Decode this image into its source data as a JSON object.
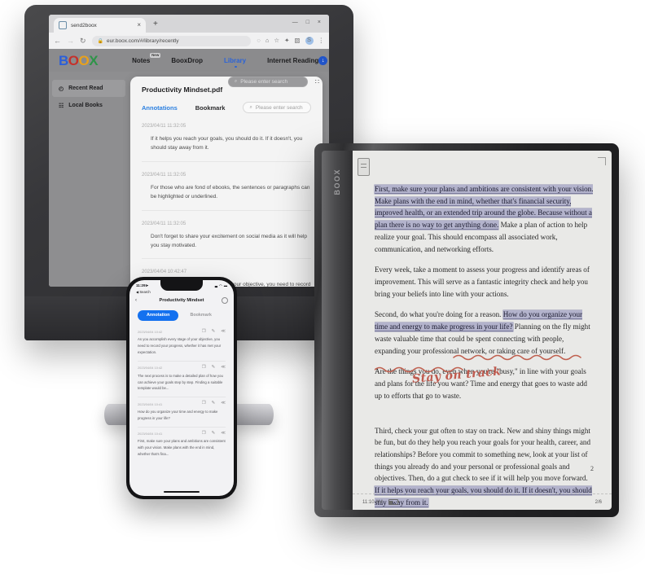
{
  "browser": {
    "tab_title": "send2boox",
    "tab_close": "×",
    "new_tab": "+",
    "window_controls": "— □ ×",
    "back_icon": "←",
    "forward_icon": "→",
    "reload_icon": "↻",
    "lock_icon": "🔒",
    "url": "eur.boox.com/#/library/recently",
    "extension_icons": [
      "◌",
      "⌂",
      "☆",
      "✦",
      "▧"
    ],
    "profile_initial": "S",
    "menu_icon": "⋮"
  },
  "site": {
    "logo": {
      "b": "B",
      "o1": "O",
      "o2": "O",
      "x": "X"
    },
    "nav": [
      {
        "label": "Notes",
        "badge": "New",
        "active": false
      },
      {
        "label": "BooxDrop",
        "badge": "",
        "active": false
      },
      {
        "label": "Library",
        "badge": "",
        "active": true
      },
      {
        "label": "Internet Reading",
        "badge": "",
        "active": false
      }
    ],
    "header_icons": [
      "download-icon",
      "storage-icon",
      "headset-icon",
      "account-icon"
    ],
    "download_glyph": "↓",
    "storage_glyph": "◎",
    "headset_glyph": "⌢",
    "account_glyph": "⚲",
    "dropdown_caret": "▾",
    "sidebar": [
      {
        "label": "Recent Read",
        "icon": "◴",
        "active": true
      },
      {
        "label": "Local Books",
        "icon": "☷",
        "active": false
      }
    ],
    "top_search": {
      "placeholder": "Please enter search",
      "icon": "⌕"
    },
    "grid_icon": "∷"
  },
  "card": {
    "title": "Productivity Mindset.pdf",
    "tabs": [
      {
        "label": "Annotations",
        "active": true
      },
      {
        "label": "Bookmark",
        "active": false
      }
    ],
    "search": {
      "placeholder": "Please enter search",
      "icon": "⌕"
    },
    "annotations": [
      {
        "date": "2023/04/11 11:32:05",
        "text": "If it helps you reach your goals, you should do it. If it doesn't, you should stay away from it."
      },
      {
        "date": "2023/04/11 11:32:05",
        "text": "For those who are fond of ebooks, the sentences or paragraphs can be highlighted or underlined."
      },
      {
        "date": "2023/04/11 11:32:05",
        "text": "Don't forget to share your excitement on social media as it will help you stay motivated."
      },
      {
        "date": "2023/04/04 10:42:47",
        "text": "As you accomplish every stage of your objective, you need to record your progress."
      }
    ]
  },
  "tablet": {
    "brand": "BOOX",
    "page_number": "2",
    "status": {
      "time": "11:10 AM",
      "battery_icon": "battery-icon",
      "progress": "2/6"
    },
    "handwritten_note": "Stay on track",
    "paragraphs": [
      {
        "runs": [
          {
            "t": "First, make sure your plans and ambitions are consistent with your vision. Make plans with the end in mind, whether that's financial security, improved health, or an extended trip around the globe. Because without a plan there is no way to get anything done.",
            "highlight": true
          },
          {
            "t": " Make a plan of action to help realize your goal. This should encompass all associated work, communication, and networking efforts.",
            "highlight": false
          }
        ]
      },
      {
        "runs": [
          {
            "t": "Every week, take a moment to assess your progress and identify areas of improvement. This will serve as a fantastic integrity check and help you bring your beliefs into line with your actions.",
            "highlight": false
          }
        ]
      },
      {
        "runs": [
          {
            "t": "Second, do what you're doing for a reason. ",
            "highlight": false
          },
          {
            "t": "How do you organize your time and energy to make progress in your life?",
            "highlight": true
          },
          {
            "t": " Planning on the fly might waste valuable time that could be spent connecting with people, expanding your professional network, or taking care of yourself.",
            "highlight": false
          }
        ]
      },
      {
        "runs": [
          {
            "t": "Are the things you do, even when you're \"busy,\" in line with your goals and plans for the life you want? Time and energy that goes to waste add up to efforts that go to waste.",
            "highlight": false
          }
        ]
      },
      {
        "runs": [
          {
            "t": "Third, check your gut often to stay on track. New and shiny things might be fun, but do they help you reach your goals for your health, career, and relationships? Before you commit to something new, look at your list of things you already do and your personal or professional goals and objectives. Then, do a gut check to see if it will help you move forward. ",
            "highlight": false
          },
          {
            "t": "If it helps you reach your goals, you should do it. If it doesn't, you should stay away from it.",
            "highlight": true
          }
        ]
      }
    ]
  },
  "phone": {
    "status": {
      "time": "11:29",
      "location_icon": "➤",
      "signal": "▃",
      "wifi": "◠",
      "battery": "▬"
    },
    "search_back": "◀ Search",
    "back_chevron": "‹",
    "title": "Productivity Mindset",
    "tabs": [
      {
        "label": "Annotation",
        "active": true
      },
      {
        "label": "Bookmark",
        "active": false
      }
    ],
    "action_icons": [
      "copy-icon",
      "edit-icon",
      "share-icon"
    ],
    "copy_glyph": "❐",
    "edit_glyph": "✎",
    "share_glyph": "≪",
    "annotations": [
      {
        "date": "2023/04/04 10:42",
        "text": "As you accomplish every stage of your objective, you need to record your progress, whether it has met your expectation."
      },
      {
        "date": "2023/04/04 10:42",
        "text": "The next process is to make a detailed plan of how you can achieve your goals step by step. Finding a suitable template would be..."
      },
      {
        "date": "2023/04/04 10:41",
        "text": "How do you organize your time and energy to make progress in your life?"
      },
      {
        "date": "2023/04/04 10:41",
        "text": "First, make sure your plans and ambitions are consistent with your vision. Make plans with the end in mind, whether that's fina..."
      }
    ]
  },
  "colors": {
    "brand_blue": "#2154c9",
    "link_blue": "#2a7fe0",
    "phone_accent": "#1471ef",
    "highlight": "#b3b3cc",
    "ink_red": "#bf5a4e"
  }
}
